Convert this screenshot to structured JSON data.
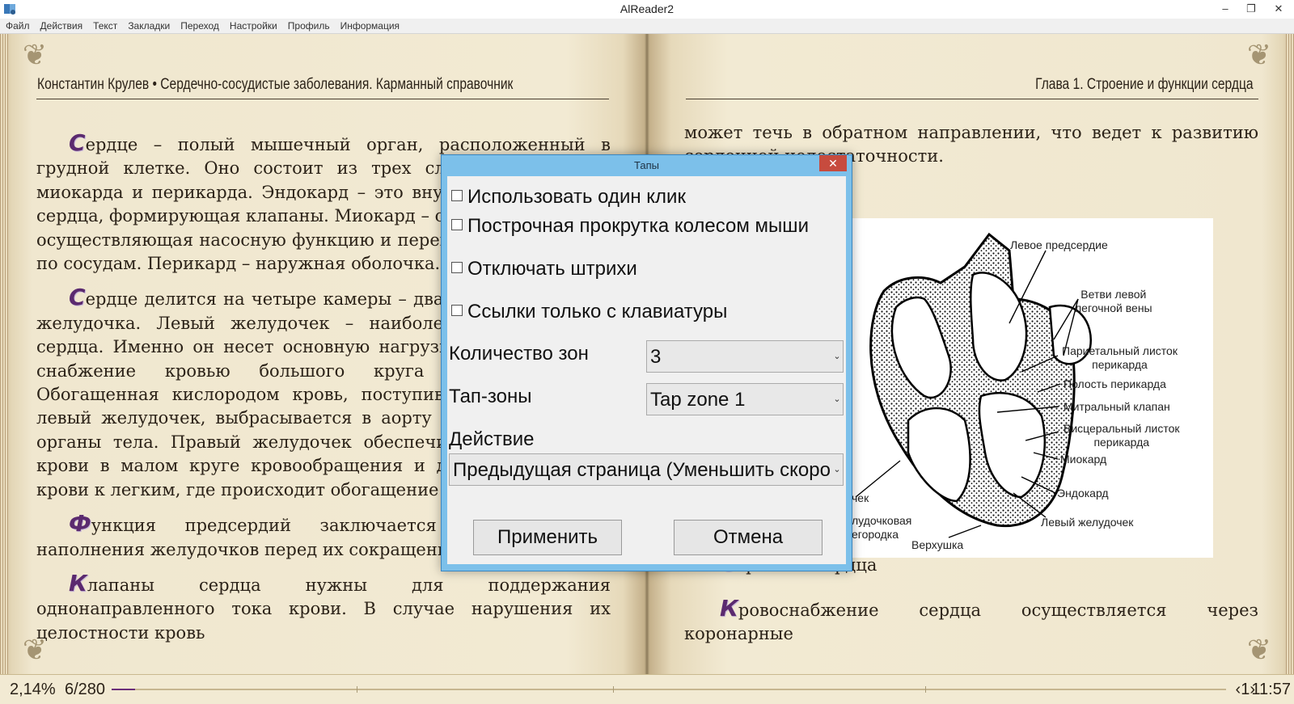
{
  "window": {
    "title": "AlReader2",
    "minimize": "–",
    "restore": "❐",
    "close": "✕"
  },
  "menu": [
    "Файл",
    "Действия",
    "Текст",
    "Закладки",
    "Переход",
    "Настройки",
    "Профиль",
    "Информация"
  ],
  "book": {
    "left_header": "Константин Крулев • Сердечно-сосудистые заболевания. Карманный справочник",
    "right_header": "Глава 1. Строение и функции сердца",
    "left_paragraphs": [
      {
        "drop": "С",
        "text": "ердце – полый мышечный орган, расположенный в грудной клетке. Оно состоит из трех слоев – эндокарда, миокарда и перикарда. Эндокард – это внутренняя выстилка сердца, формирующая клапаны. Миокард – собственно мышца, осуществляющая насосную функцию и перекачивающая кровь по сосудам. Перикард – наружная оболочка."
      },
      {
        "drop": "С",
        "text": "ердце делится на четыре камеры – два предсердия и два желудочка. Левый желудочек – наиболее мощный отдел сердца. Именно он несет основную нагрузку. Его функция – снабжение кровью большого круга кровообращения. Обогащенная кислородом кровь, поступившая из легких в левый желудочек, выбрасывается в аорту и из нее – во все органы тела. Правый желудочек обеспечивает циркуляцию крови в малом круге кровообращения и доставку венозной крови к легким, где происходит обогащение ее кислородом."
      },
      {
        "drop": "Ф",
        "text": "ункция предсердий заключается в увеличении наполнения желудочков перед их сокращением."
      },
      {
        "drop": "К",
        "text": "лапаны сердца нужны для поддержания однонаправленного тока крови. В случае нарушения их целостности кровь"
      }
    ],
    "right_top_text": "может течь в обратном направлении, что ведет к развитию сердечной недостаточности.",
    "figure_labels": {
      "left_atrium": "Левое предсердие",
      "pulmonary_veins": "Ветви левой\nлегочной вены",
      "parietal": "Париетальный листок\nперикарда",
      "cavity": "Полость перикарда",
      "mitral": "Митральный клапан",
      "visceral": "Висцеральный листок\nперикарда",
      "myocardium": "Миокард",
      "endocardium": "Эндокард",
      "left_ventricle": "Левый желудочек",
      "apex": "Верхушка",
      "vent_partial": "чек",
      "av_partial": "лудочковая\nегородка"
    },
    "caption_drop": "С",
    "caption": "троение сердца",
    "right_para_drop": "К",
    "right_para": "ровоснабжение сердца осуществляется через коронарные"
  },
  "status": {
    "percent": "2,14%",
    "page": "6/280",
    "progress": 0.0214,
    "nav": "‹1›",
    "clock": "11:57"
  },
  "dialog": {
    "title": "Тапы",
    "close": "✕",
    "checkbox1": "Использовать один клик",
    "checkbox2": "Построчная прокрутка колесом мыши",
    "checkbox3": "Отключать штрихи",
    "checkbox4": "Ссылки только с клавиатуры",
    "zones_label": "Количество зон",
    "zones_value": "3",
    "tapzones_label": "Тап-зоны",
    "tapzones_value": "Tap zone 1",
    "action_label": "Действие",
    "action_value": "Предыдущая страница (Уменьшить скорость)",
    "apply": "Применить",
    "cancel": "Отмена"
  }
}
